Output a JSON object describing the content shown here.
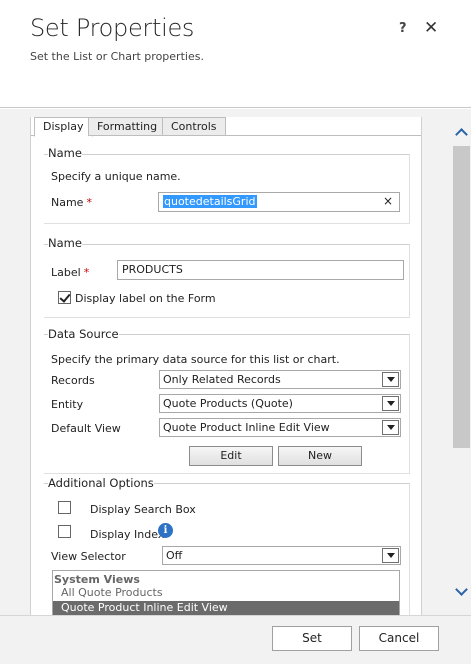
{
  "dialog": {
    "title": "Set Properties",
    "subtitle": "Set the List or Chart properties.",
    "help_label": "?",
    "close_label": "✕"
  },
  "tabs": [
    {
      "label": "Display",
      "active": true
    },
    {
      "label": "Formatting",
      "active": false
    },
    {
      "label": "Controls",
      "active": false
    }
  ],
  "name_section": {
    "title": "Name",
    "description": "Specify a unique name.",
    "name_label": "Name",
    "required_mark": "*",
    "name_value": "quotedetailsGrid",
    "clear_label": "×"
  },
  "label_section": {
    "title": "Name",
    "label_label": "Label",
    "required_mark": "*",
    "label_value": "PRODUCTS",
    "display_label_text": "Display label on the Form",
    "display_label_checked": true
  },
  "data_source": {
    "title": "Data Source",
    "description": "Specify the primary data source for this list or chart.",
    "records_label": "Records",
    "records_value": "Only Related Records",
    "entity_label": "Entity",
    "entity_value": "Quote Products (Quote)",
    "default_view_label": "Default View",
    "default_view_value": "Quote Product Inline Edit View",
    "edit_label": "Edit",
    "new_label": "New"
  },
  "additional_options": {
    "title": "Additional Options",
    "search_box_label": "Display Search Box",
    "search_box_checked": false,
    "index_label": "Display Index",
    "index_checked": false,
    "info_icon_glyph": "i",
    "view_selector_label": "View Selector",
    "view_selector_value": "Off",
    "views_group": "System Views",
    "views": [
      {
        "label": "All Quote Products",
        "selected": false
      },
      {
        "label": "Quote Product Inline Edit View",
        "selected": true
      }
    ]
  },
  "footer": {
    "set_label": "Set",
    "cancel_label": "Cancel"
  },
  "colors": {
    "selection": "#3399ff",
    "required": "#c00000",
    "info_icon": "#2d72c5",
    "scroll_arrow": "#2a64a8",
    "selected_view": "#6b6b6b"
  }
}
